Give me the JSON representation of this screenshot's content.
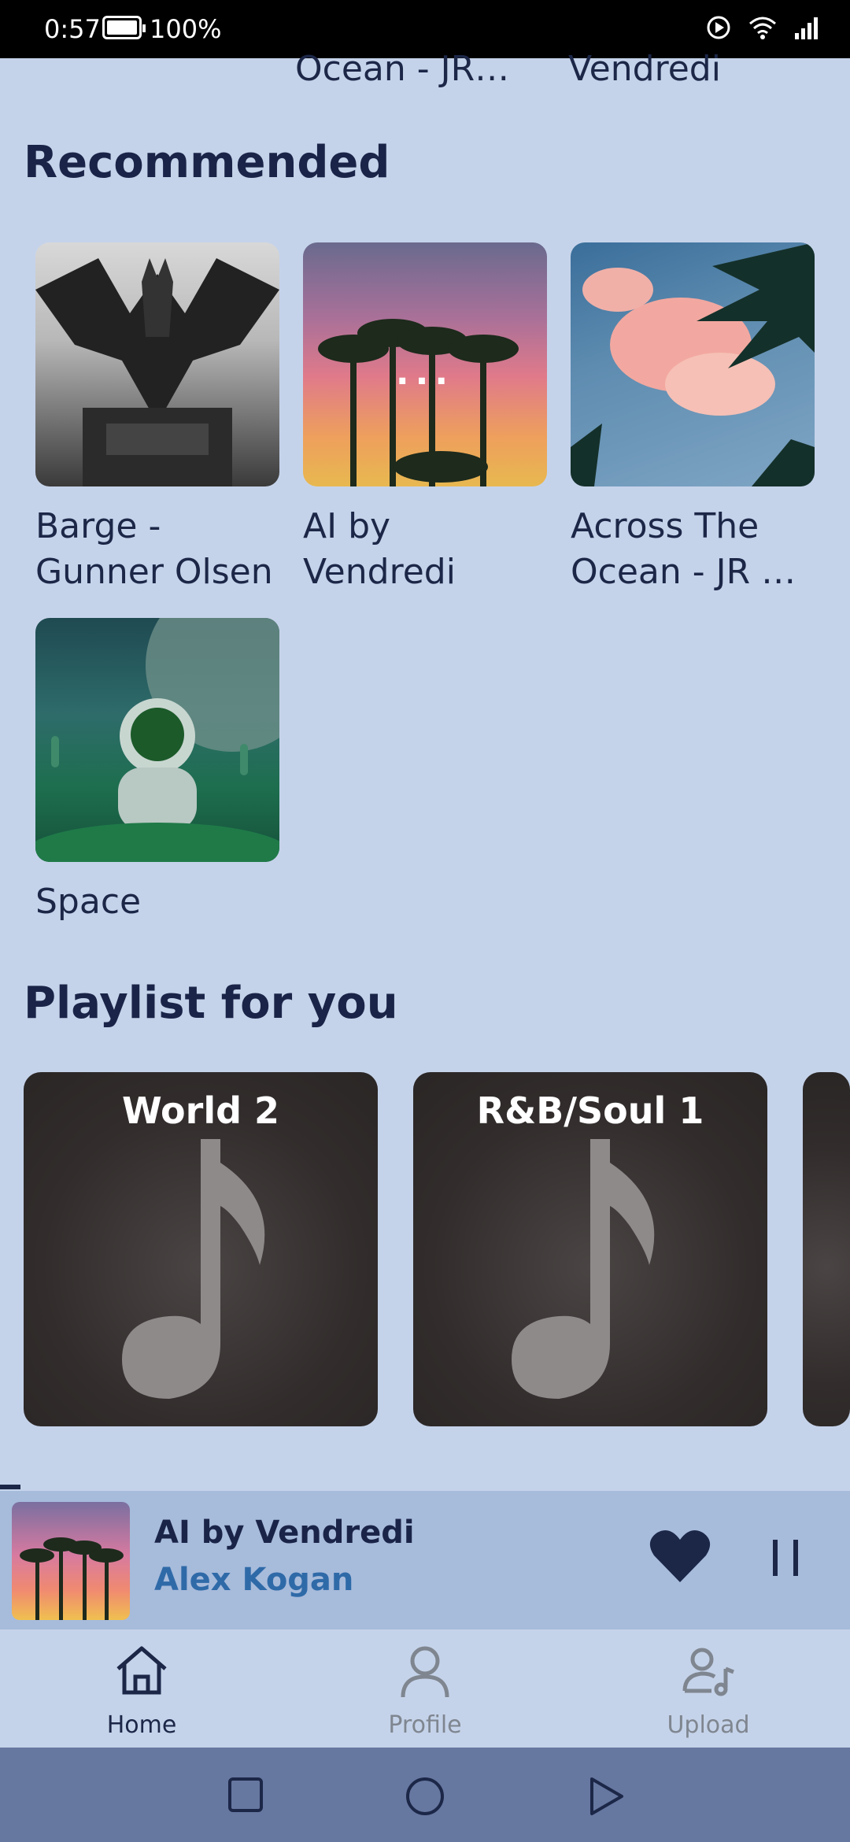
{
  "status_bar": {
    "time": "0:57",
    "battery": "100%"
  },
  "top_partial": [
    "Ocean - JR…",
    "Vendredi"
  ],
  "recommended": {
    "title": "Recommended",
    "items": [
      {
        "label": "Barge - Gunner Olsen",
        "art": "batman"
      },
      {
        "label": "AI by Vendredi",
        "art": "palms-sunset",
        "loading": "..."
      },
      {
        "label": "Across The Ocean - JR …",
        "art": "palm-clouds"
      },
      {
        "label": "Space",
        "art": "astronaut"
      }
    ]
  },
  "playlists": {
    "title": "Playlist for you",
    "items": [
      {
        "title": "World  2"
      },
      {
        "title": "R&B/Soul  1"
      }
    ]
  },
  "mini_player": {
    "title": "AI by Vendredi",
    "artist": "Alex Kogan",
    "accent": "#2f6aa8"
  },
  "bottom_nav": [
    {
      "label": "Home",
      "icon": "home-icon",
      "active": true
    },
    {
      "label": "Profile",
      "icon": "profile-icon",
      "active": false
    },
    {
      "label": "Upload",
      "icon": "upload-music-icon",
      "active": false
    }
  ],
  "colors": {
    "background": "#c5d3ea",
    "mini_player_bg": "#a7bbdb",
    "system_nav": "#6677a0",
    "text_dark": "#1a2448"
  }
}
